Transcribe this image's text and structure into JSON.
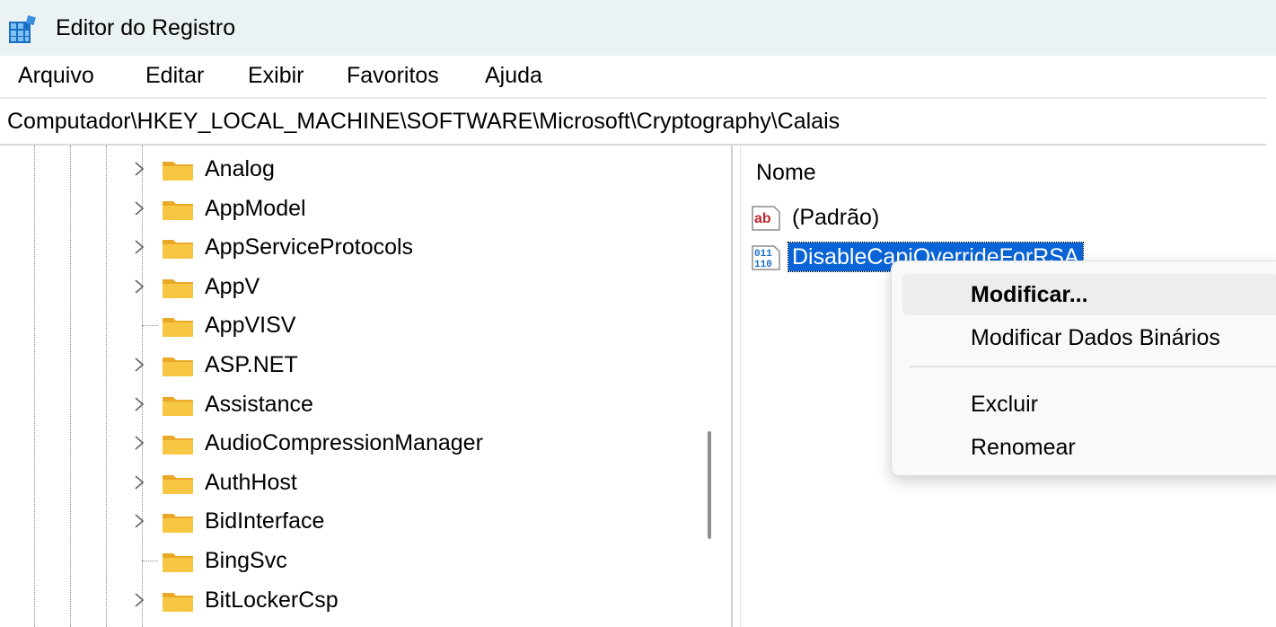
{
  "window": {
    "title": "Editor do Registro"
  },
  "menu": [
    "Arquivo",
    "Editar",
    "Exibir",
    "Favoritos",
    "Ajuda"
  ],
  "address": "Computador\\HKEY_LOCAL_MACHINE\\SOFTWARE\\Microsoft\\Cryptography\\Calais",
  "tree": {
    "items": [
      {
        "label": "Analog",
        "has_children": true
      },
      {
        "label": "AppModel",
        "has_children": true
      },
      {
        "label": "AppServiceProtocols",
        "has_children": true
      },
      {
        "label": "AppV",
        "has_children": true
      },
      {
        "label": "AppVISV",
        "has_children": false
      },
      {
        "label": "ASP.NET",
        "has_children": true
      },
      {
        "label": "Assistance",
        "has_children": true
      },
      {
        "label": "AudioCompressionManager",
        "has_children": true
      },
      {
        "label": "AuthHost",
        "has_children": true
      },
      {
        "label": "BidInterface",
        "has_children": true
      },
      {
        "label": "BingSvc",
        "has_children": false
      },
      {
        "label": "BitLockerCsp",
        "has_children": true
      }
    ]
  },
  "list": {
    "column_name": "Nome",
    "rows": [
      {
        "label": "(Padrão)",
        "icon": "string-value-icon",
        "selected": false
      },
      {
        "label": "DisableCapiOverrideForRSA",
        "icon": "binary-value-icon",
        "selected": true
      }
    ]
  },
  "context_menu": {
    "items": [
      {
        "label": "Modificar...",
        "bold": true,
        "hover": true
      },
      {
        "label": "Modificar Dados Binários",
        "bold": false
      },
      {
        "label": "Excluir",
        "bold": false
      },
      {
        "label": "Renomear",
        "bold": false
      }
    ]
  },
  "colors": {
    "selection": "#0a64d6",
    "folder": "#f7c744",
    "titlebar": "#ebf2f4"
  }
}
